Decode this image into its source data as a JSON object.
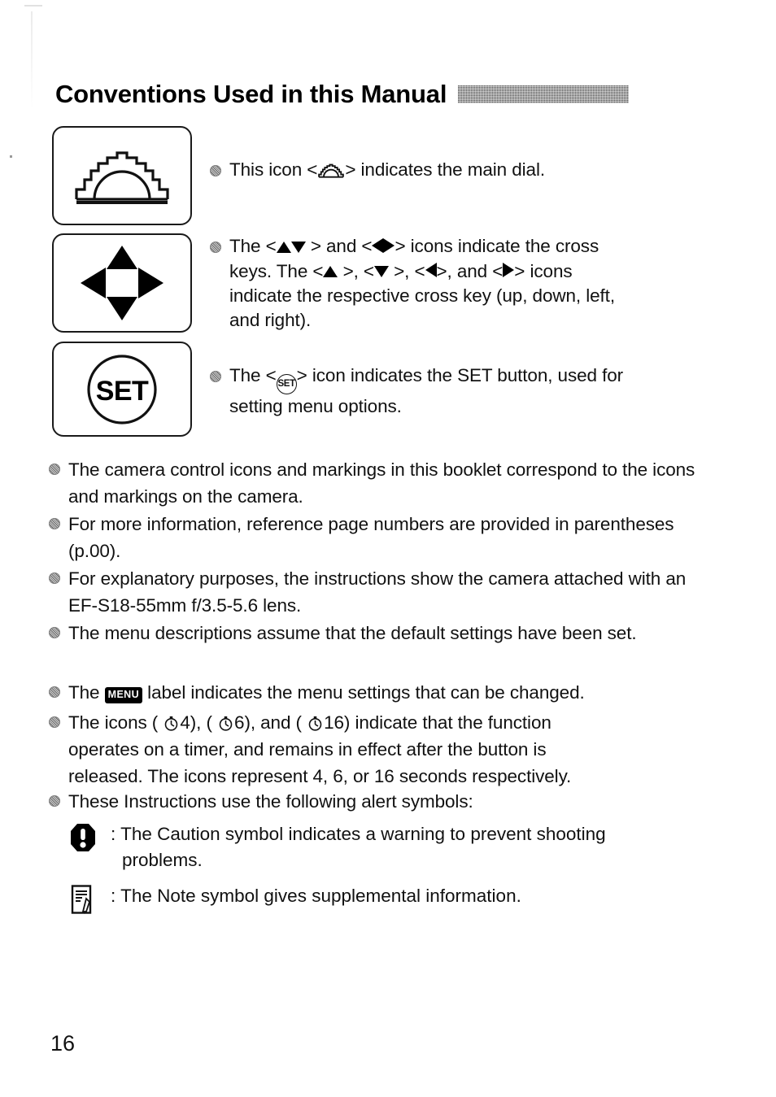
{
  "page": {
    "title": "Conventions Used in this Manual",
    "page_number": "16",
    "header_bar_color": "#8e8e8e",
    "bullet_color": "#8a8a8a",
    "ink_color": "#111111"
  },
  "icon_boxes": [
    {
      "name": "main-dial",
      "icon": "main-dial-icon",
      "label": "Main dial"
    },
    {
      "name": "cross-keys",
      "icon": "cross-keys-icon",
      "label": "Cross keys"
    },
    {
      "name": "set-button",
      "icon": "set-button-icon",
      "label": "SET"
    }
  ],
  "entries": [
    {
      "id": "dial",
      "icon": "main-dial-icon",
      "text_before": "This icon <",
      "inline_icon": "main-dial-icon",
      "text_after": "> indicates the main dial.",
      "full_text": "This icon < > indicates the main dial."
    },
    {
      "id": "cross",
      "icon": "cross-keys-icon",
      "full_text": "The <  > and <  > icons indicate the cross keys. The < >, < >, < >, and < > icons indicate the respective cross key (up, down, left, and right).",
      "fragments": {
        "f1": "The <",
        "f2": "> and <",
        "f3": "> icons indicate the cross",
        "f4": "keys. The <",
        "f5": ">, <",
        "f6": ">, <",
        "f7": ">, and <",
        "f8": "> icons",
        "f9": "indicate the respective cross key (up, down, left,",
        "f10": "and right)."
      }
    },
    {
      "id": "set",
      "icon": "set-button-icon",
      "set_label": "SET",
      "fragments": {
        "f1": "The <",
        "f2": "> icon indicates the SET button, used for",
        "f3": "setting menu options."
      },
      "full_text": "The < > icon indicates the SET button, used for setting menu options."
    }
  ],
  "bullets": [
    {
      "id": "b0",
      "text": "The camera control icons and markings in this booklet correspond to the icons and markings on the camera."
    },
    {
      "id": "b1",
      "text": "For more information, reference page numbers are provided in parentheses (p.00)."
    },
    {
      "id": "b2",
      "text": "For explanatory purposes, the instructions show the camera attached with an EF-S18-55mm f/3.5-5.6 lens."
    },
    {
      "id": "b3",
      "text": "The menu descriptions assume that the default settings have been set."
    }
  ],
  "menu_bullet": {
    "before": "The ",
    "badge": "MENU",
    "after": " label indicates the menu settings that can be changed."
  },
  "timer_bullet": {
    "f1": "The icons ( ",
    "v1": "4",
    "f2": "), ( ",
    "v2": "6",
    "f3": "), and ( ",
    "v3": "16",
    "f4": ") indicate that the function",
    "line2": "operates on a timer, and remains in effect after the button is",
    "line3": "released. The icons represent 4, 6, or 16 seconds respectively.",
    "timer_values": [
      "4",
      "6",
      "16"
    ]
  },
  "alerts_intro": "These Instructions use the following alert symbols:",
  "alerts": [
    {
      "id": "caution",
      "icon": "caution-icon",
      "line1": ": The Caution symbol indicates a warning to prevent shooting",
      "line2": "problems.",
      "full_text": ": The Caution symbol indicates a warning to prevent shooting problems."
    },
    {
      "id": "note",
      "icon": "note-icon",
      "line1": ": The Note symbol gives supplemental information.",
      "line2": "",
      "full_text": ": The Note symbol gives supplemental information."
    }
  ]
}
